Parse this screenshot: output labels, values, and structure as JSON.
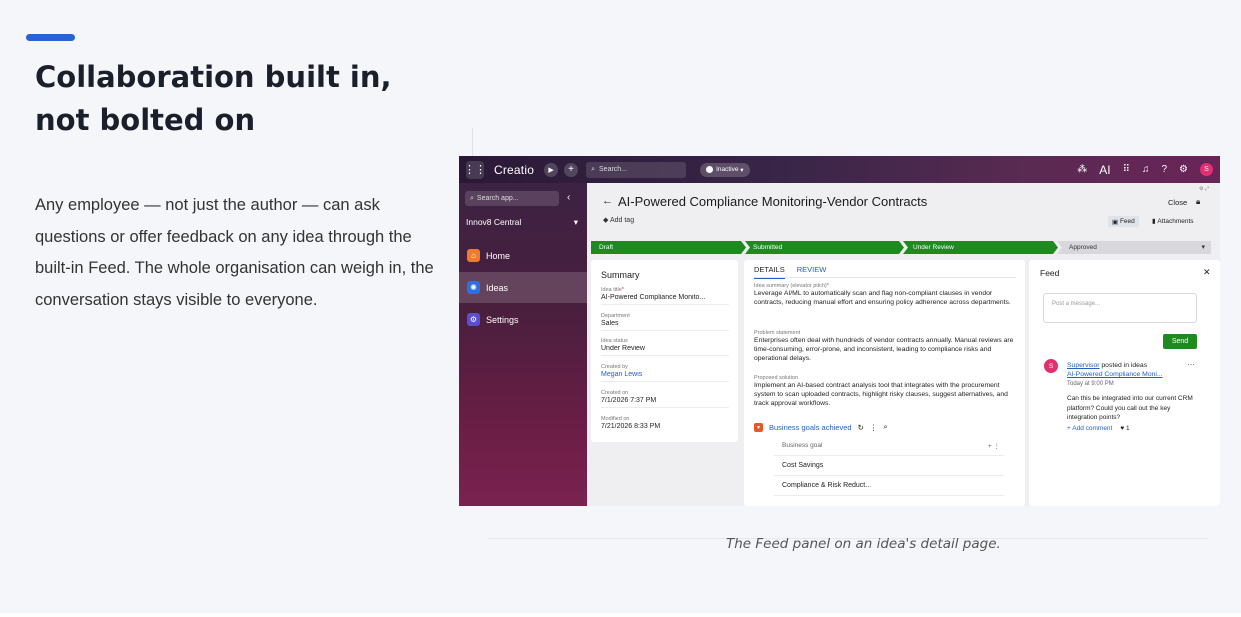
{
  "slide": {
    "title": "Collaboration built in, not bolted on",
    "body": "Any employee — not just the author — can ask questions or offer feedback on any idea through the built-in Feed. The whole organisation can weigh in, the conversation stays visible to everyone.",
    "caption": "The Feed panel on an idea's detail page.",
    "accent_color": "#2563d9"
  },
  "app": {
    "brand": "Creatio",
    "search_placeholder": "Search...",
    "status_pill": "Inactive",
    "ai_label": "AI",
    "avatar_letter": "S",
    "icons": [
      "apps-grid-icon",
      "play-icon",
      "plus-icon",
      "search-icon",
      "wifi-icon",
      "apps-icon",
      "bell-icon",
      "help-icon",
      "gear-icon"
    ]
  },
  "sidebar": {
    "search_placeholder": "Search app...",
    "collapse_glyph": "‹",
    "workspace": "Innov8 Central",
    "items": [
      {
        "label": "Home",
        "icon": "home-icon",
        "color": "#f07a2e"
      },
      {
        "label": "Ideas",
        "icon": "idea-icon",
        "color": "#2f6fe0"
      },
      {
        "label": "Settings",
        "icon": "settings-icon",
        "color": "#5a4fd0"
      }
    ]
  },
  "record": {
    "title": "AI-Powered Compliance Monitoring-Vendor Contracts",
    "add_tag": "Add tag",
    "close_label": "Close",
    "feed_tab": "Feed",
    "attachments_tab": "Attachments"
  },
  "stages": [
    {
      "label": "Draft",
      "done": true
    },
    {
      "label": "Submitted",
      "done": true
    },
    {
      "label": "Under Review",
      "done": true
    },
    {
      "label": "Approved",
      "done": false
    }
  ],
  "summary": {
    "title": "Summary",
    "fields": [
      {
        "label": "Idea title",
        "value": "AI-Powered Compliance Monito...",
        "required": true,
        "link": false
      },
      {
        "label": "Department",
        "value": "Sales",
        "required": false,
        "link": false
      },
      {
        "label": "Idea status",
        "value": "Under Review",
        "required": false,
        "link": false
      },
      {
        "label": "Created by",
        "value": "Megan Lewis",
        "required": false,
        "link": true
      },
      {
        "label": "Created on",
        "value": "7/1/2026 7:37 PM",
        "required": false,
        "link": false
      },
      {
        "label": "Modified on",
        "value": "7/21/2026 8:33 PM",
        "required": false,
        "link": false
      }
    ]
  },
  "details": {
    "tab_details": "DETAILS",
    "tab_review": "REVIEW",
    "elevator_label": "Idea summary (elevator pitch)",
    "elevator_value": "Leverage AI/ML to automatically scan and flag non-compliant clauses in vendor contracts, reducing manual effort and ensuring policy adherence across departments.",
    "problem_label": "Problem statement",
    "problem_value": "Enterprises often deal with hundreds of vendor contracts annually. Manual reviews are time-consuming, error-prone, and inconsistent, leading to compliance risks and operational delays.",
    "solution_label": "Proposed solution",
    "solution_value": "Implement an AI-based contract analysis tool that integrates with the procurement system to scan uploaded contracts, highlight risky clauses, suggest alternatives, and track approval workflows.",
    "goals_label": "Business goals achieved",
    "goals_header": "Business goal",
    "goals": [
      "Cost Savings",
      "Compliance & Risk Reduct..."
    ]
  },
  "feed": {
    "title": "Feed",
    "post_placeholder": "Post a message...",
    "send_label": "Send",
    "post": {
      "avatar": "S",
      "author": "Supervisor",
      "posted_in": " posted in ideas",
      "link": "AI-Powered Compliance Moni...",
      "time": "Today at 9:00 PM",
      "text": "Can this be integrated into our current CRM platform? Could you call out the key integration points?",
      "add_comment": "Add comment",
      "likes": "1"
    }
  }
}
